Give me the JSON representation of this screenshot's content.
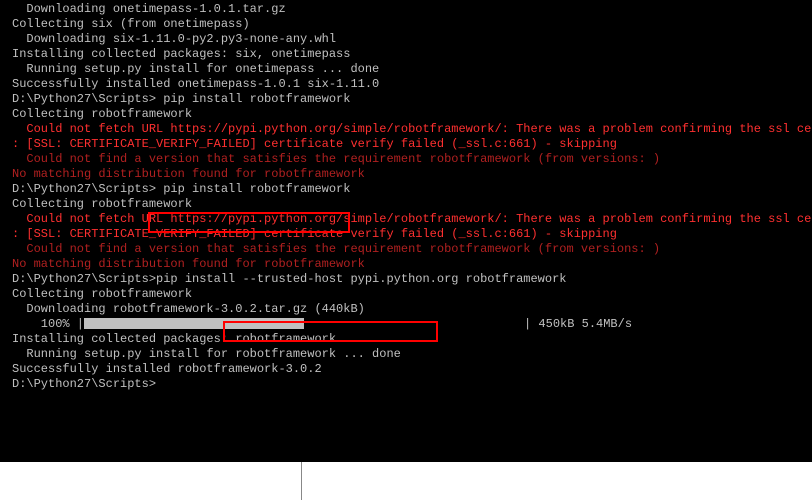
{
  "lines": {
    "l1": "  Downloading onetimepass-1.0.1.tar.gz",
    "l2": "Collecting six (from onetimepass)",
    "l3": "  Downloading six-1.11.0-py2.py3-none-any.whl",
    "l4": "Installing collected packages: six, onetimepass",
    "l5": "  Running setup.py install for onetimepass ... done",
    "l6": "Successfully installed onetimepass-1.0.1 six-1.11.0",
    "l7": "",
    "l8": "D:\\Python27\\Scripts> pip install robotframework",
    "l9": "Collecting robotframework",
    "l10": "  Could not fetch URL https://pypi.python.org/simple/robotframework/: There was a problem confirming the ssl certifica",
    "l11": ": [SSL: CERTIFICATE_VERIFY_FAILED] certificate verify failed (_ssl.c:661) - skipping",
    "l12": "  Could not find a version that satisfies the requirement robotframework (from versions: )",
    "l13": "No matching distribution found for robotframework",
    "l14": "",
    "l15": "D:\\Python27\\Scripts> pip install robotframework",
    "l16": "Collecting robotframework",
    "l17": "  Could not fetch URL https://pypi.python.org/simple/robotframework/: There was a problem confirming the ssl certifica",
    "l18": ": [SSL: CERTIFICATE_VERIFY_FAILED] certificate verify failed (_ssl.c:661) - skipping",
    "l19": "  Could not find a version that satisfies the requirement robotframework (from versions: )",
    "l20": "No matching distribution found for robotframework",
    "l21": "",
    "l22": "D:\\Python27\\Scripts>pip install --trusted-host pypi.python.org robotframework",
    "l23": "Collecting robotframework",
    "l24": "  Downloading robotframework-3.0.2.tar.gz (440kB)",
    "l25_prefix": "    100% |",
    "l25_suffix": "| 450kB 5.4MB/s",
    "l26": "Installing collected packages: robotframework",
    "l27": "  Running setup.py install for robotframework ... done",
    "l28": "Successfully installed robotframework-3.0.2",
    "l29": "",
    "l30": "D:\\Python27\\Scripts>"
  }
}
